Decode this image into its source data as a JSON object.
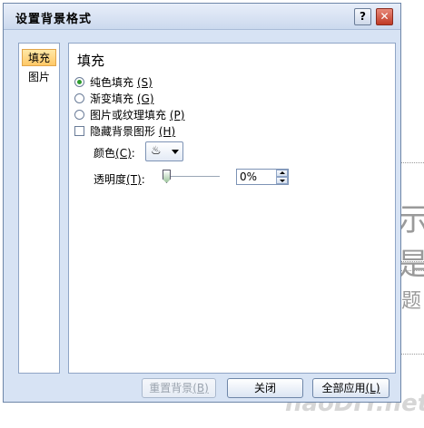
{
  "dialog": {
    "title": "设置背景格式",
    "help_label": "?",
    "close_label": "✕"
  },
  "nav": {
    "items": [
      {
        "label": "填充",
        "active": true
      },
      {
        "label": "图片",
        "active": false
      }
    ]
  },
  "fill": {
    "section_title": "填充",
    "options": [
      {
        "label": "纯色填充",
        "key": "(S)",
        "checked": true
      },
      {
        "label": "渐变填充",
        "key": "(G)",
        "checked": false
      },
      {
        "label": "图片或纹理填充",
        "key": "(P)",
        "checked": false
      }
    ],
    "hide_graphics": {
      "label": "隐藏背景图形",
      "key": "(H)",
      "checked": false
    },
    "color_label": "颜色",
    "color_key": "(C)",
    "color_icon": "paint-bucket-icon",
    "transparency_label": "透明度",
    "transparency_key": "(T)",
    "transparency_value": "0%",
    "transparency_level": 0
  },
  "footer": {
    "reset_label": "重置背景",
    "reset_key": "(B)",
    "close_label": "关闭",
    "apply_all_label": "全部应用",
    "apply_all_key": "(L)"
  },
  "background": {
    "slide_glyphs": [
      "示是",
      "题"
    ],
    "watermark": "haoDIY.net"
  }
}
